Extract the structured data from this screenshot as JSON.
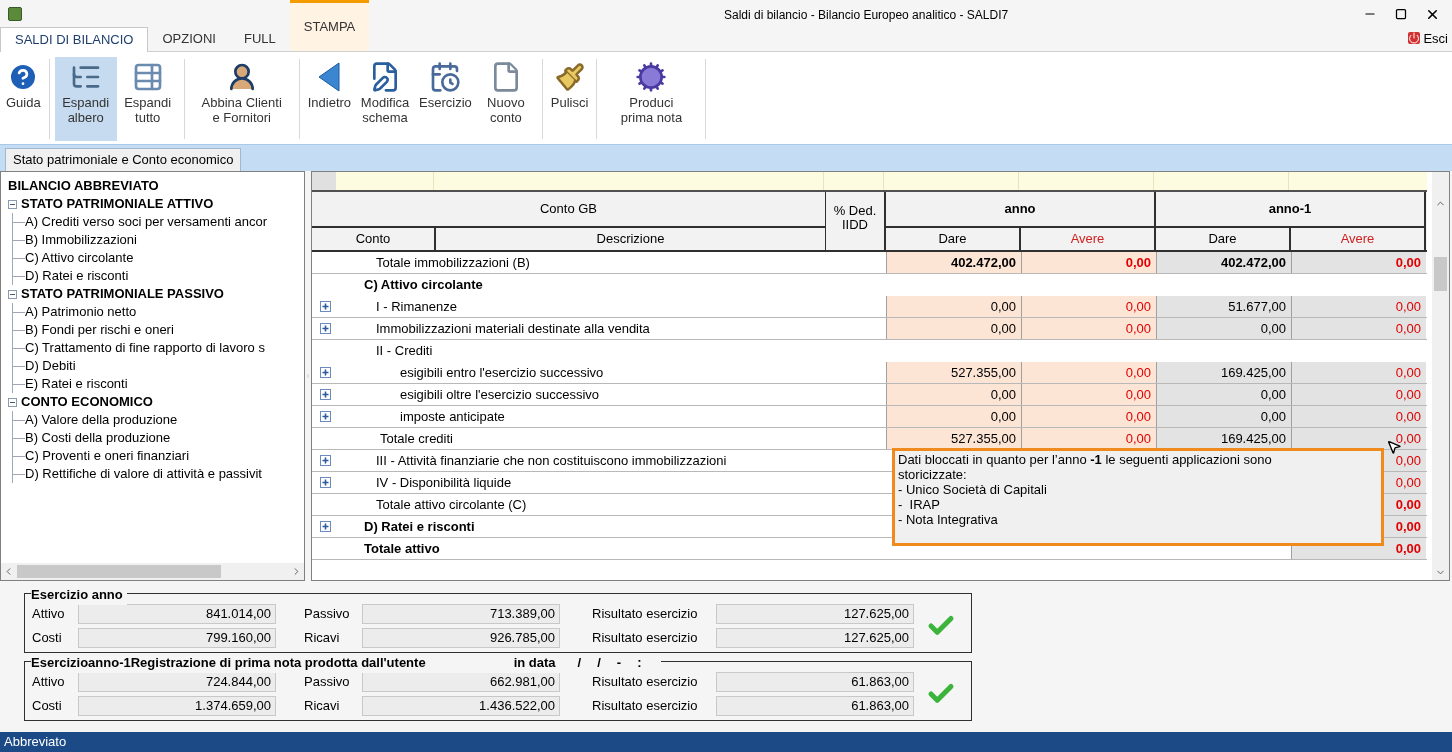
{
  "window": {
    "title": "Saldi di bilancio - Bilancio Europeo analitico - SALDI7"
  },
  "menu_tabs": [
    {
      "label": "SALDI DI BILANCIO",
      "selected": true,
      "highlighted": false
    },
    {
      "label": "OPZIONI",
      "selected": false,
      "highlighted": false
    },
    {
      "label": "FULL",
      "selected": false,
      "highlighted": false
    },
    {
      "label": "STAMPA",
      "selected": false,
      "highlighted": true
    }
  ],
  "exit_button": {
    "label": "Esci"
  },
  "toolbar": [
    {
      "kind": "help",
      "label": "Guida",
      "selected": false
    },
    {
      "kind": "expand-tree",
      "label": "Espandi albero",
      "selected": true
    },
    {
      "kind": "expand-all",
      "label": "Espandi tutto",
      "selected": false
    },
    {
      "kind": "match",
      "label": "Abbina Clienti e Fornitori",
      "selected": false
    },
    {
      "kind": "back",
      "label": "Indietro",
      "selected": false
    },
    {
      "kind": "edit",
      "label": "Modifica schema",
      "selected": false
    },
    {
      "kind": "year",
      "label": "Esercizio",
      "selected": false
    },
    {
      "kind": "new",
      "label": "Nuovo conto",
      "selected": false
    },
    {
      "kind": "clean",
      "label": "Pulisci",
      "selected": false
    },
    {
      "kind": "produce",
      "label": "Produci prima nota",
      "selected": false
    }
  ],
  "view_tab": {
    "label": "Stato patrimoniale e Conto economico",
    "selected": true
  },
  "tree": {
    "label": "BILANCIO ABBREVIATO",
    "children": [
      {
        "label": "STATO PATRIMONIALE ATTIVO",
        "expanded": true,
        "children": [
          {
            "label": "A) Crediti verso soci per versamenti ancor"
          },
          {
            "label": "B) Immobilizzazioni"
          },
          {
            "label": "C) Attivo circolante"
          },
          {
            "label": "D) Ratei e risconti"
          }
        ]
      },
      {
        "label": "STATO PATRIMONIALE PASSIVO",
        "expanded": true,
        "children": [
          {
            "label": "A) Patrimonio netto"
          },
          {
            "label": "B) Fondi per rischi e oneri"
          },
          {
            "label": "C) Trattamento di fine rapporto di lavoro s"
          },
          {
            "label": "D) Debiti"
          },
          {
            "label": "E) Ratei e risconti"
          }
        ]
      },
      {
        "label": "CONTO ECONOMICO",
        "expanded": true,
        "children": [
          {
            "label": "A) Valore della produzione"
          },
          {
            "label": "B) Costi della produzione"
          },
          {
            "label": "C) Proventi e oneri finanziari"
          },
          {
            "label": "D) Rettifiche di valore di attività e passivit"
          }
        ]
      }
    ]
  },
  "grid": {
    "header": {
      "account_group": "Conto GB",
      "account": "Conto",
      "description": "Descrizione",
      "deduction": "% Ded. IIDD",
      "periods": [
        {
          "label": "anno",
          "debit": "Dare",
          "credit": "Avere"
        },
        {
          "label": "anno-1",
          "debit": "Dare",
          "credit": "Avere"
        }
      ]
    },
    "rows": [
      {
        "kind": "total",
        "label": "Totale immobilizzazioni (B)",
        "expandable": false,
        "bold_values": true,
        "values": {
          "anno_dare": "402.472,00",
          "anno_avere": "0,00",
          "prev_dare": "402.472,00",
          "prev_avere": "0,00"
        }
      },
      {
        "kind": "section",
        "label": "C) Attivo circolante",
        "expandable": false
      },
      {
        "kind": "item",
        "label": "I - Rimanenze",
        "expandable": true,
        "bold_values": false,
        "values": {
          "anno_dare": "0,00",
          "anno_avere": "0,00",
          "prev_dare": "51.677,00",
          "prev_avere": "0,00"
        }
      },
      {
        "kind": "item",
        "label": "Immobilizzazioni materiali destinate alla vendita",
        "expandable": true,
        "bold_values": false,
        "values": {
          "anno_dare": "0,00",
          "anno_avere": "0,00",
          "prev_dare": "0,00",
          "prev_avere": "0,00"
        }
      },
      {
        "kind": "heading",
        "label": "II - Crediti",
        "expandable": false
      },
      {
        "kind": "subitem",
        "label": "esigibili entro l'esercizio successivo",
        "expandable": true,
        "bold_values": false,
        "values": {
          "anno_dare": "527.355,00",
          "anno_avere": "0,00",
          "prev_dare": "169.425,00",
          "prev_avere": "0,00"
        }
      },
      {
        "kind": "subitem",
        "label": "esigibili oltre l'esercizio successivo",
        "expandable": true,
        "bold_values": false,
        "values": {
          "anno_dare": "0,00",
          "anno_avere": "0,00",
          "prev_dare": "0,00",
          "prev_avere": "0,00"
        }
      },
      {
        "kind": "subitem",
        "label": "imposte anticipate",
        "expandable": true,
        "bold_values": false,
        "values": {
          "anno_dare": "0,00",
          "anno_avere": "0,00",
          "prev_dare": "0,00",
          "prev_avere": "0,00"
        }
      },
      {
        "kind": "subtotal",
        "label": "Totale crediti",
        "expandable": false,
        "bold_values": false,
        "values": {
          "anno_dare": "527.355,00",
          "anno_avere": "0,00",
          "prev_dare": "169.425,00",
          "prev_avere": "0,00"
        }
      },
      {
        "kind": "item",
        "label": "III - Attività finanziarie che non costituiscono immobilizzazioni",
        "expandable": true,
        "bold_values": false,
        "values": {
          "prev_avere": "0,00"
        }
      },
      {
        "kind": "item",
        "label": "IV - Disponibilità liquide",
        "expandable": true,
        "bold_values": false,
        "values": {
          "prev_avere": "0,00"
        }
      },
      {
        "kind": "total",
        "label": "Totale attivo circolante (C)",
        "expandable": false,
        "bold_values": true,
        "values": {
          "prev_avere": "0,00"
        }
      },
      {
        "kind": "section",
        "label": "D) Ratei e risconti",
        "expandable": true,
        "bold_values": true,
        "values": {
          "prev_avere": "0,00"
        }
      },
      {
        "kind": "grand",
        "label": "Totale attivo",
        "expandable": false,
        "bold_values": true,
        "values": {
          "prev_avere": "0,00"
        }
      }
    ],
    "tooltip": {
      "intro": "Dati bloccati in quanto per l’anno **-1**      le seguenti applicazioni sono storicizzate:",
      "items": [
        "- Unico Società di Capitali",
        "-  IRAP",
        "- Nota Integrativa"
      ]
    }
  },
  "summaries": [
    {
      "legend": [
        "Esercizio anno"
      ],
      "ok": true,
      "rows": [
        [
          {
            "label": "Attivo",
            "value": "841.014,00"
          },
          {
            "label": "Passivo",
            "value": "713.389,00"
          },
          {
            "label": "Risultato esercizio",
            "value": "127.625,00"
          }
        ],
        [
          {
            "label": "Costi",
            "value": "799.160,00"
          },
          {
            "label": "Ricavi",
            "value": "926.785,00"
          },
          {
            "label": "Risultato esercizio",
            "value": "127.625,00"
          }
        ]
      ]
    },
    {
      "legend": [
        "Esercizio",
        "anno-1",
        "Registrazione di prima nota prodotta dall'utente",
        "in data",
        "/",
        "/",
        "-",
        ":"
      ],
      "ok": true,
      "rows": [
        [
          {
            "label": "Attivo",
            "value": "724.844,00"
          },
          {
            "label": "Passivo",
            "value": "662.981,00"
          },
          {
            "label": "Risultato esercizio",
            "value": "61.863,00"
          }
        ],
        [
          {
            "label": "Costi",
            "value": "1.374.659,00"
          },
          {
            "label": "Ricavi",
            "value": "1.436.522,00"
          },
          {
            "label": "Risultato esercizio",
            "value": "61.863,00"
          }
        ]
      ]
    }
  ],
  "status_bar": {
    "text": "Abbreviato"
  }
}
